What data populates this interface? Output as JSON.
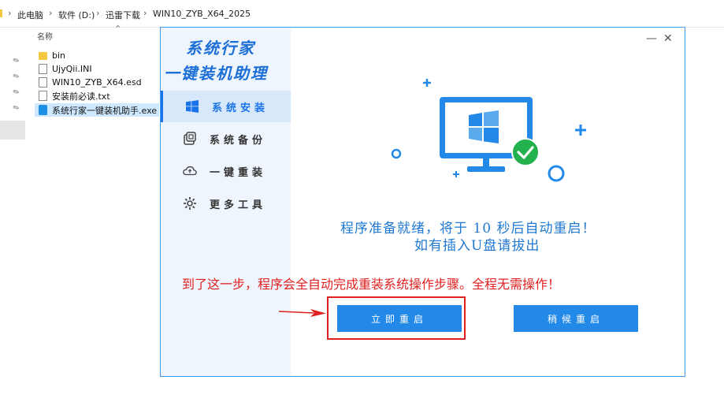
{
  "breadcrumb": {
    "items": [
      "此电脑",
      "软件 (D:)",
      "迅雷下载",
      "WIN10_ZYB_X64_2025"
    ]
  },
  "file_list": {
    "column_name": "名称",
    "files": [
      {
        "name": "bin",
        "icon": "folder-icon"
      },
      {
        "name": "UjyQii.INI",
        "icon": "ini-file-icon"
      },
      {
        "name": "WIN10_ZYB_X64.esd",
        "icon": "file-icon"
      },
      {
        "name": "安装前必读.txt",
        "icon": "text-file-icon"
      },
      {
        "name": "系统行家一键装机助手.exe",
        "icon": "app-icon"
      }
    ]
  },
  "app": {
    "logo_line1": "系统行家",
    "logo_line2": "一键装机助理",
    "minimize": "—",
    "close": "✕",
    "nav": [
      {
        "label": "系统安装",
        "icon": "windows-icon",
        "active": true
      },
      {
        "label": "系统备份",
        "icon": "backup-icon",
        "active": false
      },
      {
        "label": "一键重装",
        "icon": "cloud-icon",
        "active": false
      },
      {
        "label": "更多工具",
        "icon": "gear-icon",
        "active": false
      }
    ],
    "message_line1": "程序准备就绪，将于 10 秒后自动重启！",
    "message_line2": "如有插入U盘请拔出",
    "restart_now": "立即重启",
    "restart_later": "稍候重启"
  },
  "annotation": {
    "text": "到了这一步，程序会全自动完成重装系统操作步骤。全程无需操作！"
  },
  "colors": {
    "accent": "#2389e8",
    "annotation_red": "#e02020",
    "check_green": "#22b14c"
  }
}
